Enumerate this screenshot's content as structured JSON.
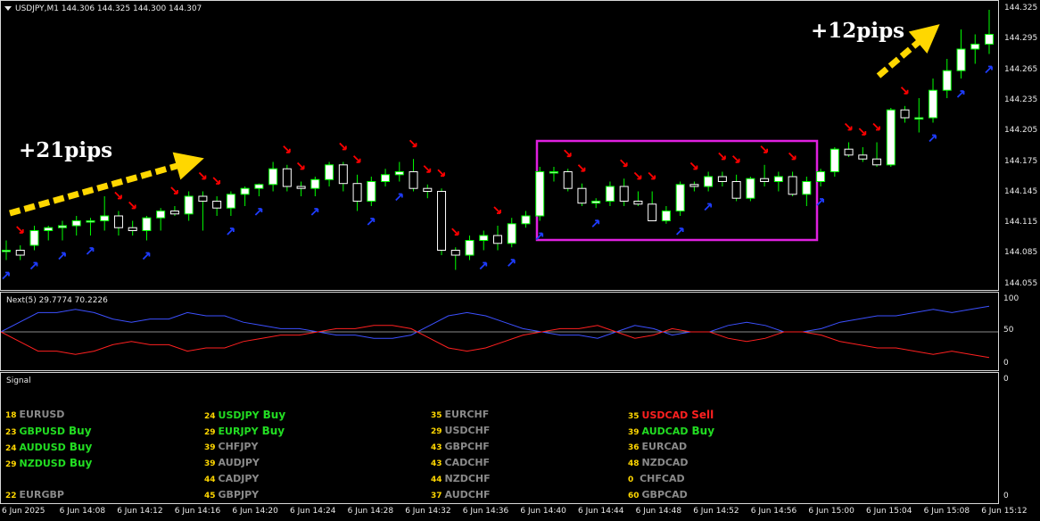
{
  "chart": {
    "symbol_header": "USDJPY,M1  144.306 144.325 144.300 144.307",
    "price_axis": [
      "144.325",
      "144.295",
      "144.265",
      "144.235",
      "144.205",
      "144.175",
      "144.145",
      "144.115",
      "144.085",
      "144.055"
    ],
    "annotations": {
      "left": "+21pips",
      "right": "+12pips"
    },
    "colors": {
      "bull": "#ffffff",
      "bear": "#ffffff",
      "wick": "#00ff00",
      "up_arrow": "#1e3cff",
      "down_arrow": "#ff0000",
      "box": "#e020e0",
      "big_arrow": "#ffd700"
    }
  },
  "chart_data": {
    "type": "candlestick",
    "ylim": [
      144.05,
      144.33
    ],
    "candles": [
      [
        144.085,
        144.095,
        144.075,
        144.085
      ],
      [
        144.085,
        144.09,
        144.075,
        144.08
      ],
      [
        144.09,
        144.11,
        144.085,
        144.105
      ],
      [
        144.105,
        144.11,
        144.095,
        144.108
      ],
      [
        144.108,
        144.115,
        144.095,
        144.11
      ],
      [
        144.11,
        144.12,
        144.1,
        144.115
      ],
      [
        144.115,
        144.118,
        144.1,
        144.115
      ],
      [
        144.115,
        144.14,
        144.105,
        144.12
      ],
      [
        144.12,
        144.125,
        144.1,
        144.108
      ],
      [
        144.108,
        144.115,
        144.1,
        144.105
      ],
      [
        144.105,
        144.12,
        144.095,
        144.118
      ],
      [
        144.118,
        144.128,
        144.105,
        144.125
      ],
      [
        144.125,
        144.13,
        144.12,
        144.122
      ],
      [
        144.122,
        144.145,
        144.115,
        144.14
      ],
      [
        144.14,
        144.145,
        144.105,
        144.135
      ],
      [
        144.135,
        144.14,
        144.12,
        144.128
      ],
      [
        144.128,
        144.145,
        144.12,
        144.142
      ],
      [
        144.142,
        144.15,
        144.13,
        144.148
      ],
      [
        144.148,
        144.153,
        144.14,
        144.152
      ],
      [
        144.152,
        144.175,
        144.145,
        144.168
      ],
      [
        144.168,
        144.172,
        144.145,
        144.15
      ],
      [
        144.15,
        144.155,
        144.14,
        144.148
      ],
      [
        144.148,
        144.16,
        144.14,
        144.157
      ],
      [
        144.157,
        144.175,
        144.15,
        144.172
      ],
      [
        144.172,
        144.175,
        144.145,
        144.153
      ],
      [
        144.153,
        144.162,
        144.125,
        144.135
      ],
      [
        144.135,
        144.16,
        144.13,
        144.155
      ],
      [
        144.155,
        144.168,
        144.15,
        144.162
      ],
      [
        144.162,
        144.175,
        144.155,
        144.165
      ],
      [
        144.165,
        144.178,
        144.145,
        144.148
      ],
      [
        144.148,
        144.152,
        144.138,
        144.145
      ],
      [
        144.145,
        144.148,
        144.08,
        144.085
      ],
      [
        144.085,
        144.088,
        144.065,
        144.08
      ],
      [
        144.08,
        144.1,
        144.075,
        144.095
      ],
      [
        144.095,
        144.105,
        144.085,
        144.1
      ],
      [
        144.1,
        144.11,
        144.085,
        144.092
      ],
      [
        144.092,
        144.118,
        144.088,
        144.112
      ],
      [
        144.112,
        144.125,
        144.108,
        144.12
      ],
      [
        144.12,
        144.17,
        144.115,
        144.165
      ],
      [
        144.165,
        144.17,
        144.155,
        144.165
      ],
      [
        144.165,
        144.168,
        144.145,
        144.148
      ],
      [
        144.148,
        144.153,
        144.13,
        144.133
      ],
      [
        144.133,
        144.138,
        144.128,
        144.135
      ],
      [
        144.135,
        144.155,
        144.13,
        144.15
      ],
      [
        144.15,
        144.158,
        144.13,
        144.135
      ],
      [
        144.135,
        144.145,
        144.13,
        144.132
      ],
      [
        144.132,
        144.145,
        144.115,
        144.115
      ],
      [
        144.115,
        144.13,
        144.112,
        144.125
      ],
      [
        144.125,
        144.155,
        144.12,
        144.152
      ],
      [
        144.152,
        144.155,
        144.145,
        144.15
      ],
      [
        144.15,
        144.165,
        144.145,
        144.16
      ],
      [
        144.16,
        144.165,
        144.15,
        144.155
      ],
      [
        144.155,
        144.162,
        144.135,
        144.138
      ],
      [
        144.138,
        144.16,
        144.135,
        144.158
      ],
      [
        144.158,
        144.172,
        144.15,
        144.155
      ],
      [
        144.155,
        144.165,
        144.145,
        144.16
      ],
      [
        144.16,
        144.165,
        144.14,
        144.142
      ],
      [
        144.142,
        144.16,
        144.13,
        144.155
      ],
      [
        144.155,
        144.168,
        144.15,
        144.165
      ],
      [
        144.165,
        144.19,
        144.16,
        144.188
      ],
      [
        144.188,
        144.195,
        144.18,
        144.182
      ],
      [
        144.182,
        144.19,
        144.175,
        144.178
      ],
      [
        144.178,
        144.195,
        144.17,
        144.172
      ],
      [
        144.172,
        144.23,
        144.17,
        144.228
      ],
      [
        144.228,
        144.232,
        144.215,
        144.22
      ],
      [
        144.22,
        144.24,
        144.205,
        144.22
      ],
      [
        144.22,
        144.26,
        144.215,
        144.248
      ],
      [
        144.248,
        144.28,
        144.24,
        144.268
      ],
      [
        144.268,
        144.31,
        144.26,
        144.29
      ],
      [
        144.29,
        144.305,
        144.275,
        144.295
      ],
      [
        144.295,
        144.33,
        144.285,
        144.305
      ]
    ],
    "oscillator": {
      "name": "Next(5)",
      "values_text": "Next(5) 29.7774 70.2226",
      "ylim": [
        0,
        100
      ],
      "ticks": [
        "100",
        "50",
        "0"
      ],
      "blue": [
        50,
        65,
        80,
        80,
        85,
        80,
        70,
        65,
        70,
        70,
        80,
        75,
        75,
        65,
        60,
        55,
        55,
        50,
        45,
        45,
        40,
        40,
        45,
        60,
        75,
        80,
        75,
        65,
        55,
        50,
        45,
        45,
        40,
        50,
        60,
        55,
        45,
        50,
        50,
        60,
        65,
        60,
        50,
        50,
        55,
        65,
        70,
        75,
        75,
        80,
        85,
        80,
        85,
        90
      ],
      "red": [
        50,
        35,
        20,
        20,
        15,
        20,
        30,
        35,
        30,
        30,
        20,
        25,
        25,
        35,
        40,
        45,
        45,
        50,
        55,
        55,
        60,
        60,
        55,
        40,
        25,
        20,
        25,
        35,
        45,
        50,
        55,
        55,
        60,
        50,
        40,
        45,
        55,
        50,
        50,
        40,
        35,
        40,
        50,
        50,
        45,
        35,
        30,
        25,
        25,
        20,
        15,
        20,
        15,
        10
      ]
    },
    "signal_scale": [
      "0",
      "0"
    ]
  },
  "signal": {
    "title": "Signal",
    "columns": [
      [
        {
          "num": "18",
          "pair": "EURUSD",
          "action": "",
          "cls": ""
        },
        {
          "num": "23",
          "pair": "GBPUSD",
          "action": "Buy",
          "cls": "buy"
        },
        {
          "num": "24",
          "pair": "AUDUSD",
          "action": "Buy",
          "cls": "buy"
        },
        {
          "num": "29",
          "pair": "NZDUSD",
          "action": "Buy",
          "cls": "buy"
        },
        {
          "num": "",
          "pair": "",
          "action": "",
          "cls": ""
        },
        {
          "num": "22",
          "pair": "EURGBP",
          "action": "",
          "cls": ""
        }
      ],
      [
        {
          "num": "24",
          "pair": "USDJPY",
          "action": "Buy",
          "cls": "buy"
        },
        {
          "num": "29",
          "pair": "EURJPY",
          "action": "Buy",
          "cls": "buy"
        },
        {
          "num": "39",
          "pair": "CHFJPY",
          "action": "",
          "cls": ""
        },
        {
          "num": "39",
          "pair": "AUDJPY",
          "action": "",
          "cls": ""
        },
        {
          "num": "44",
          "pair": "CADJPY",
          "action": "",
          "cls": ""
        },
        {
          "num": "45",
          "pair": "GBPJPY",
          "action": "",
          "cls": ""
        }
      ],
      [
        {
          "num": "35",
          "pair": "EURCHF",
          "action": "",
          "cls": ""
        },
        {
          "num": "29",
          "pair": "USDCHF",
          "action": "",
          "cls": ""
        },
        {
          "num": "43",
          "pair": "GBPCHF",
          "action": "",
          "cls": ""
        },
        {
          "num": "43",
          "pair": "CADCHF",
          "action": "",
          "cls": ""
        },
        {
          "num": "44",
          "pair": "NZDCHF",
          "action": "",
          "cls": ""
        },
        {
          "num": "37",
          "pair": "AUDCHF",
          "action": "",
          "cls": ""
        }
      ],
      [
        {
          "num": "35",
          "pair": "USDCAD",
          "action": "Sell",
          "cls": "sell"
        },
        {
          "num": "39",
          "pair": "AUDCAD",
          "action": "Buy",
          "cls": "buy"
        },
        {
          "num": "36",
          "pair": "EURCAD",
          "action": "",
          "cls": ""
        },
        {
          "num": "48",
          "pair": "NZDCAD",
          "action": "",
          "cls": ""
        },
        {
          "num": "0",
          "pair": " CHFCAD",
          "action": "",
          "cls": ""
        },
        {
          "num": "60",
          "pair": "GBPCAD",
          "action": "",
          "cls": ""
        }
      ]
    ]
  },
  "time_axis": [
    "6 Jun 2025",
    "6 Jun 14:08",
    "6 Jun 14:12",
    "6 Jun 14:16",
    "6 Jun 14:20",
    "6 Jun 14:24",
    "6 Jun 14:28",
    "6 Jun 14:32",
    "6 Jun 14:36",
    "6 Jun 14:40",
    "6 Jun 14:44",
    "6 Jun 14:48",
    "6 Jun 14:52",
    "6 Jun 14:56",
    "6 Jun 15:00",
    "6 Jun 15:04",
    "6 Jun 15:08",
    "6 Jun 15:12"
  ]
}
